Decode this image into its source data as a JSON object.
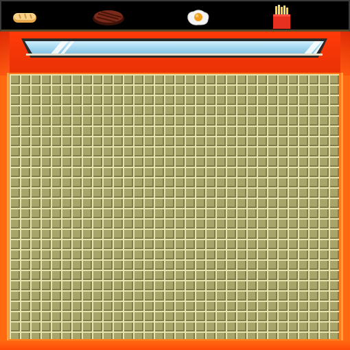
{
  "scene": "kitchen-counter-grid",
  "inventory": {
    "items": [
      {
        "name": "bread",
        "icon": "bread-icon"
      },
      {
        "name": "steak",
        "icon": "steak-icon"
      },
      {
        "name": "fried-egg",
        "icon": "fried-egg-icon"
      },
      {
        "name": "fries",
        "icon": "fries-icon"
      }
    ]
  },
  "colors": {
    "frame": "#ff6a10",
    "header": "#ff3a08",
    "floor": "#a8a56a",
    "grid_light": "#e8e4b0",
    "grid_dark": "#7f7c4a",
    "glass": "#9fd4ee"
  }
}
